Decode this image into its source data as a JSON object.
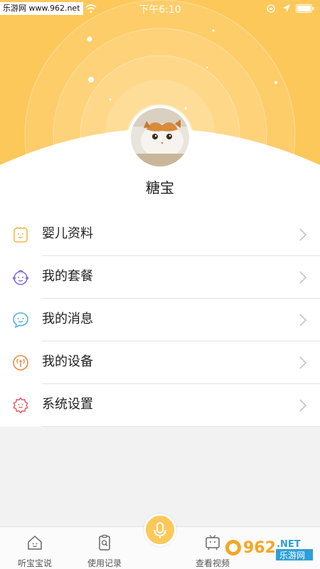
{
  "status_bar": {
    "site_tag": "乐游网 www.962.net",
    "time": "下午6:10"
  },
  "profile": {
    "name": "糖宝"
  },
  "menu": {
    "items": [
      {
        "label": "婴儿资料",
        "icon": "baby-info-icon",
        "color": "#f5b94a"
      },
      {
        "label": "我的套餐",
        "icon": "baby-face-icon",
        "color": "#8a6fd6"
      },
      {
        "label": "我的消息",
        "icon": "chat-bubble-icon",
        "color": "#4fb3e0"
      },
      {
        "label": "我的设备",
        "icon": "device-signal-icon",
        "color": "#f08a46"
      },
      {
        "label": "系统设置",
        "icon": "gear-icon",
        "color": "#e25a63"
      }
    ]
  },
  "tabs": {
    "items": [
      {
        "label": "听宝宝说",
        "icon": "house-icon"
      },
      {
        "label": "使用记录",
        "icon": "clipboard-search-icon"
      },
      {
        "label": "查看视频",
        "icon": "tv-robot-icon"
      }
    ],
    "center_icon": "microphone-icon"
  },
  "watermark": {
    "text_962": "962",
    "text_net": ".NET",
    "text_cn": "乐游网"
  },
  "colors": {
    "accent": "#fdc85a",
    "separator": "#e2e2e2",
    "background": "#f2f2f2"
  }
}
